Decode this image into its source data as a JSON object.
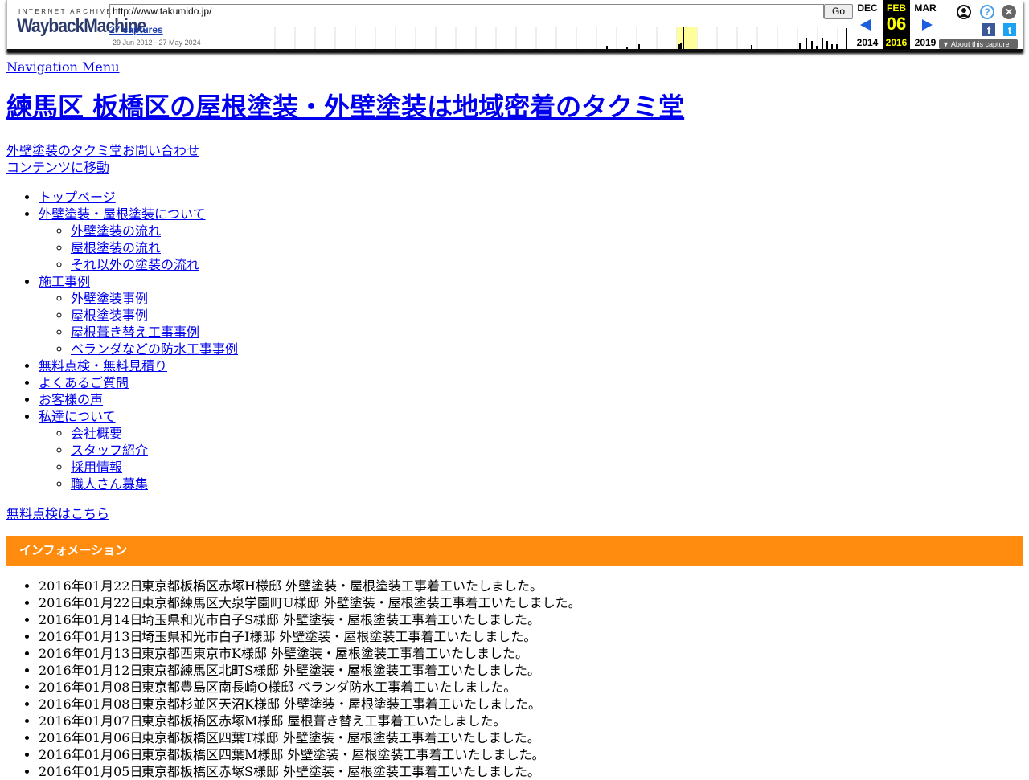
{
  "wayback": {
    "logo_top": "INTERNET ARCHIVE",
    "logo_main": "WaybackMachine",
    "url": "http://www.takumido.jp/",
    "go_label": "Go",
    "captures": "27 captures",
    "range": "29 Jun 2012 - 27 May 2024",
    "prev": {
      "month": "DEC",
      "year": "2014"
    },
    "current": {
      "month": "FEB",
      "day": "06",
      "year": "2016"
    },
    "next": {
      "month": "MAR",
      "year": "2019"
    },
    "about": "About this capture",
    "icons": {
      "user": "user-icon",
      "help": "help-icon",
      "close": "close-icon",
      "facebook": "facebook-icon",
      "twitter": "twitter-icon"
    }
  },
  "page": {
    "nav_menu_alt": "Navigation Menu",
    "site_title": "練馬区 板橋区の屋根塗装・外壁塗装は地域密着のタクミ堂",
    "contact_alt": "外壁塗装のタクミ堂お問い合わせ",
    "skip_link": "コンテンツに移動",
    "menu": [
      {
        "label": "トップページ",
        "children": []
      },
      {
        "label": "外壁塗装・屋根塗装について",
        "children": [
          "外壁塗装の流れ",
          "屋根塗装の流れ",
          "それ以外の塗装の流れ"
        ]
      },
      {
        "label": "施工事例",
        "children": [
          "外壁塗装事例",
          "屋根塗装事例",
          "屋根葺き替え工事事例",
          "ベランダなどの防水工事事例"
        ]
      },
      {
        "label": "無料点検・無料見積り",
        "children": []
      },
      {
        "label": "よくあるご質問",
        "children": []
      },
      {
        "label": "お客様の声",
        "children": []
      },
      {
        "label": "私達について",
        "children": [
          "会社概要",
          "スタッフ紹介",
          "採用情報",
          "職人さん募集"
        ]
      }
    ],
    "free_inspect_alt": "無料点検はこちら",
    "info_heading": "インフォメーション",
    "news": [
      {
        "date": "2016年01月22日",
        "text": "東京都板橋区赤塚H様邸 外壁塗装・屋根塗装工事着工いたしました。"
      },
      {
        "date": "2016年01月22日",
        "text": "東京都練馬区大泉学園町U様邸 外壁塗装・屋根塗装工事着工いたしました。"
      },
      {
        "date": "2016年01月14日",
        "text": "埼玉県和光市白子S様邸 外壁塗装・屋根塗装工事着工いたしました。"
      },
      {
        "date": "2016年01月13日",
        "text": "埼玉県和光市白子I様邸 外壁塗装・屋根塗装工事着工いたしました。"
      },
      {
        "date": "2016年01月13日",
        "text": "東京都西東京市K様邸 外壁塗装・屋根塗装工事着工いたしました。"
      },
      {
        "date": "2016年01月12日",
        "text": "東京都練馬区北町S様邸 外壁塗装・屋根塗装工事着工いたしました。"
      },
      {
        "date": "2016年01月08日",
        "text": "東京都豊島区南長崎O様邸 ベランダ防水工事着工いたしました。"
      },
      {
        "date": "2016年01月08日",
        "text": "東京都杉並区天沼K様邸 外壁塗装・屋根塗装工事着工いたしました。"
      },
      {
        "date": "2016年01月07日",
        "text": "東京都板橋区赤塚M様邸 屋根葺き替え工事着工いたしました。"
      },
      {
        "date": "2016年01月06日",
        "text": "東京都板橋区四葉T様邸 外壁塗装・屋根塗装工事着工いたしました。"
      },
      {
        "date": "2016年01月06日",
        "text": "東京都板橋区四葉M様邸 外壁塗装・屋根塗装工事着工いたしました。"
      },
      {
        "date": "2016年01月05日",
        "text": "東京都板橋区赤塚S様邸 外壁塗装・屋根塗装工事着工いたしました。"
      }
    ]
  },
  "colors": {
    "info_bar": "#ff8c0f",
    "link": "#0000ee",
    "wayback_current": "#000000"
  }
}
